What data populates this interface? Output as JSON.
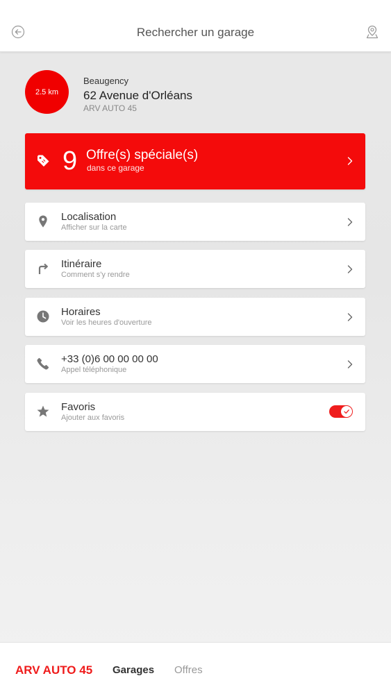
{
  "header": {
    "title": "Rechercher un garage",
    "back_icon": "back-arrow-circle-icon",
    "map_icon": "map-pin-user-icon"
  },
  "garage": {
    "distance": "2.5 km",
    "city": "Beaugency",
    "address": "62 Avenue d'Orléans",
    "name": "ARV AUTO 45"
  },
  "offers": {
    "count": "9",
    "title": "Offre(s) spéciale(s)",
    "subtitle": "dans ce garage",
    "icon": "tag-icon"
  },
  "rows": [
    {
      "title": "Localisation",
      "subtitle": "Afficher sur la carte",
      "icon": "location-pin-icon"
    },
    {
      "title": "Itinéraire",
      "subtitle": "Comment s'y rendre",
      "icon": "turn-right-arrow-icon"
    },
    {
      "title": "Horaires",
      "subtitle": "Voir les heures d'ouverture",
      "icon": "clock-icon"
    },
    {
      "title": "+33 (0)6 00 00 00 00",
      "subtitle": "Appel téléphonique",
      "icon": "phone-icon"
    },
    {
      "title": "Favoris",
      "subtitle": "Ajouter aux favoris",
      "icon": "star-icon",
      "toggle_on": true
    }
  ],
  "bottom_nav": {
    "brand": "ARV AUTO 45",
    "items": [
      {
        "label": "Garages",
        "active": true
      },
      {
        "label": "Offres",
        "active": false
      }
    ]
  },
  "colors": {
    "accent": "#f40b0b",
    "icon_gray": "#777777"
  }
}
